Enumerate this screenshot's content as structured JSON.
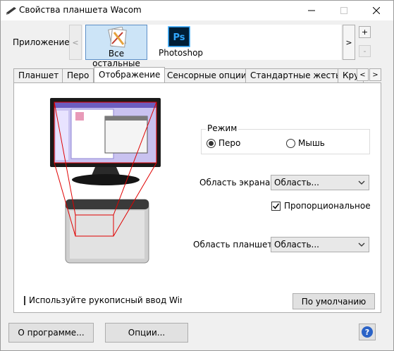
{
  "window": {
    "title": "Свойства планшета Wacom"
  },
  "application": {
    "label": "Приложение:",
    "items": [
      {
        "label": "Все остальные",
        "icon": "all-applications-icon",
        "selected": true
      },
      {
        "label": "Photoshop",
        "icon": "photoshop-icon",
        "selected": false
      }
    ],
    "add": "+",
    "remove": "-"
  },
  "tabs": [
    {
      "label": "Планшет"
    },
    {
      "label": "Перо"
    },
    {
      "label": "Отображение",
      "active": true
    },
    {
      "label": "Сенсорные опции"
    },
    {
      "label": "Стандартные жесты"
    },
    {
      "label": "Кру"
    }
  ],
  "mapping": {
    "mode_title": "Режим",
    "mode_pen": "Перо",
    "mode_mouse": "Мышь",
    "mode_selected": "Перо",
    "screen_area_label": "Область экрана:",
    "screen_area_value": "Область...",
    "proportional_label": "Пропорциональное",
    "proportional_checked": true,
    "tablet_area_label": "Область планшета:",
    "tablet_area_value": "Область...",
    "windows_ink_label": "Используйте рукописный ввод Windows Ink",
    "windows_ink_checked": false,
    "default_button": "По умолчанию"
  },
  "footer": {
    "about_button": "О программе...",
    "options_button": "Опции...",
    "help_button": "?"
  },
  "colors": {
    "selection_bg": "#cce4f7",
    "photoshop_blue": "#31a8ff",
    "mapping_lines": "#e00000"
  }
}
